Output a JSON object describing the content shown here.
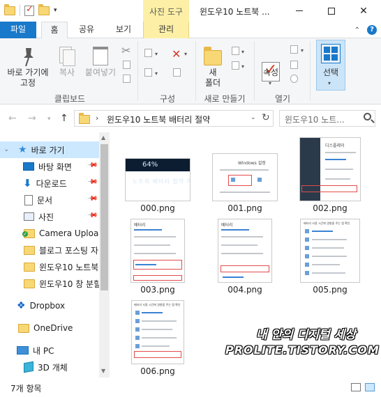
{
  "window": {
    "context_tab": "사진 도구",
    "title": "윈도우10 노트북 ..."
  },
  "ribbon_tabs": {
    "file": "파일",
    "home": "홈",
    "share": "공유",
    "view": "보기",
    "manage": "관리"
  },
  "ribbon": {
    "pin_quick_access": "바로 가기에\n고정",
    "copy": "복사",
    "paste": "붙여넣기",
    "clipboard_group": "클립보드",
    "organize_group": "구성",
    "new_folder": "새\n폴더",
    "new_group": "새로 만들기",
    "properties": "속성",
    "open_group": "열기",
    "select": "선택"
  },
  "address": {
    "path": "윈도우10 노트북 배터리 절약",
    "search_placeholder": "윈도우10 노트..."
  },
  "nav": {
    "quick_access": "바로 가기",
    "items": [
      {
        "label": "바탕 화면",
        "icon": "desktop-icon",
        "pinned": true
      },
      {
        "label": "다운로드",
        "icon": "download-icon",
        "pinned": true
      },
      {
        "label": "문서",
        "icon": "document-icon",
        "pinned": true
      },
      {
        "label": "사진",
        "icon": "pictures-icon",
        "pinned": true
      },
      {
        "label": "Camera Uploads",
        "icon": "folder-sync-icon",
        "pinned": false
      },
      {
        "label": "블로그 포스팅 자",
        "icon": "folder-icon",
        "pinned": false
      },
      {
        "label": "윈도우10 노트북",
        "icon": "folder-icon",
        "pinned": false
      },
      {
        "label": "윈도우10 창 분할",
        "icon": "folder-icon",
        "pinned": false
      }
    ],
    "dropbox": "Dropbox",
    "onedrive": "OneDrive",
    "this_pc": "내 PC",
    "objects_3d": "3D 개체"
  },
  "files": [
    {
      "name": "000.png",
      "thumb_caption": "64%"
    },
    {
      "name": "001.png",
      "thumb_caption": "Windows 설정"
    },
    {
      "name": "002.png",
      "thumb_caption": "디스플레이"
    },
    {
      "name": "003.png",
      "thumb_caption": "배터리"
    },
    {
      "name": "004.png",
      "thumb_caption": "배터리"
    },
    {
      "name": "005.png",
      "thumb_caption": "배터리 사용 시간에 영향을 주는 앱 확인"
    },
    {
      "name": "006.png",
      "thumb_caption": "배터리 사용 시간에 영향을 주는 앱 확인"
    }
  ],
  "thumb0_overlay": "노트북 배터리 절약 하는 방법",
  "status": {
    "item_count": "7개 항목"
  },
  "watermark": {
    "line1": "내 안의 디지털 세상",
    "line2": "PROLITE.TISTORY.COM"
  },
  "colors": {
    "accent": "#1979ca",
    "context_tab": "#fdf0a6",
    "selection": "#cce8ff"
  }
}
